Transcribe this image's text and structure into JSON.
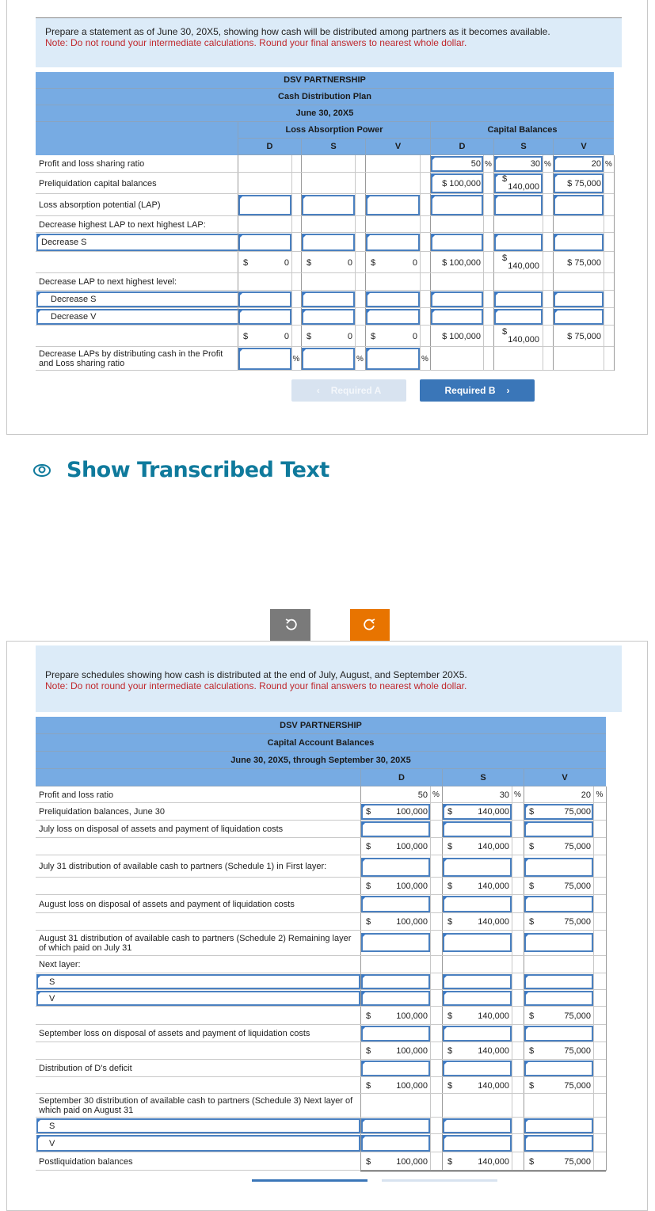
{
  "part_a": {
    "instruction": "Prepare a statement as of June 30, 20X5, showing how cash will be distributed among partners as it becomes available.",
    "note": "Note: Do not round your intermediate calculations. Round your final answers to nearest whole dollar.",
    "table": {
      "title": "DSV PARTNERSHIP",
      "subtitle": "Cash Distribution Plan",
      "date": "June 30, 20X5",
      "group_lap": "Loss Absorption Power",
      "group_cap": "Capital Balances",
      "columns": [
        "D",
        "S",
        "V",
        "D",
        "S",
        "V"
      ],
      "rows": [
        {
          "label": "Profit and loss sharing ratio",
          "lap": [
            null,
            null,
            null
          ],
          "cap": [
            {
              "t": "inval",
              "v": "50",
              "s": "%"
            },
            {
              "t": "inval",
              "v": "30",
              "s": "%"
            },
            {
              "t": "inval",
              "v": "20",
              "s": "%"
            }
          ]
        },
        {
          "label": "Preliquidation capital balances",
          "lap": [
            null,
            null,
            null
          ],
          "cap": [
            {
              "t": "inval",
              "v": "$ 100,000"
            },
            {
              "t": "inval2",
              "v": "140,000",
              "p": "$"
            },
            {
              "t": "inval",
              "v": "$ 75,000"
            }
          ]
        },
        {
          "label": "Loss absorption potential (LAP)",
          "lap": [
            {
              "t": "in"
            },
            {
              "t": "in"
            },
            {
              "t": "in"
            }
          ],
          "cap": [
            {
              "t": "in"
            },
            {
              "t": "in"
            },
            {
              "t": "in"
            }
          ]
        },
        {
          "label": "Decrease highest LAP to next highest LAP:",
          "lap": [
            null,
            null,
            null
          ],
          "cap": [
            null,
            null,
            null
          ]
        },
        {
          "label": "Decrease S",
          "select": true,
          "lap": [
            {
              "t": "in"
            },
            {
              "t": "in"
            },
            {
              "t": "in"
            }
          ],
          "cap": [
            {
              "t": "in"
            },
            {
              "t": "in"
            },
            {
              "t": "in"
            }
          ]
        },
        {
          "label": "",
          "lap": [
            {
              "t": "val",
              "p": "$",
              "v": "0"
            },
            {
              "t": "val",
              "p": "$",
              "v": "0"
            },
            {
              "t": "val",
              "p": "$",
              "v": "0"
            }
          ],
          "cap": [
            {
              "t": "val",
              "v": "$ 100,000"
            },
            {
              "t": "val2",
              "p": "$",
              "v": "140,000"
            },
            {
              "t": "val",
              "v": "$ 75,000"
            }
          ]
        },
        {
          "label": "Decrease LAP to next highest level:",
          "lap": [
            null,
            null,
            null
          ],
          "cap": [
            null,
            null,
            null
          ]
        },
        {
          "label": "Decrease S",
          "select": true,
          "indent": true,
          "lap": [
            {
              "t": "in"
            },
            {
              "t": "in"
            },
            {
              "t": "in"
            }
          ],
          "cap": [
            {
              "t": "in"
            },
            {
              "t": "in"
            },
            {
              "t": "in"
            }
          ]
        },
        {
          "label": "Decrease V",
          "select": true,
          "indent": true,
          "lap": [
            {
              "t": "in"
            },
            {
              "t": "in"
            },
            {
              "t": "in"
            }
          ],
          "cap": [
            {
              "t": "in"
            },
            {
              "t": "in"
            },
            {
              "t": "in"
            }
          ]
        },
        {
          "label": "",
          "lap": [
            {
              "t": "val",
              "p": "$",
              "v": "0"
            },
            {
              "t": "val",
              "p": "$",
              "v": "0"
            },
            {
              "t": "val",
              "p": "$",
              "v": "0"
            }
          ],
          "cap": [
            {
              "t": "val",
              "v": "$ 100,000"
            },
            {
              "t": "val2",
              "p": "$",
              "v": "140,000"
            },
            {
              "t": "val",
              "v": "$ 75,000"
            }
          ]
        },
        {
          "label": "Decrease LAPs by distributing cash in the Profit and Loss sharing ratio",
          "lap": [
            {
              "t": "in",
              "s": "%"
            },
            {
              "t": "in",
              "s": "%"
            },
            {
              "t": "in",
              "s": "%"
            }
          ],
          "cap": [
            null,
            null,
            null
          ]
        }
      ]
    },
    "nav": {
      "prev_label": "Required A",
      "next_label": "Required B"
    }
  },
  "transcribed": {
    "label": "Show Transcribed Text"
  },
  "toolbar": {
    "undo": "undo-icon",
    "redo": "redo-icon",
    "redo_color": "#e87400"
  },
  "part_b": {
    "instruction": "Prepare schedules showing how cash is distributed at the end of July, August, and September 20X5.",
    "note": "Note: Do not round your intermediate calculations. Round your final answers to nearest whole dollar.",
    "table": {
      "title": "DSV PARTNERSHIP",
      "subtitle": "Capital Account Balances",
      "date": "June 30, 20X5, through September 30, 20X5",
      "columns": [
        "D",
        "S",
        "V"
      ],
      "rows": [
        {
          "label": "Profit and loss ratio",
          "cells": [
            {
              "t": "pct",
              "v": "50"
            },
            {
              "t": "pct",
              "v": "30"
            },
            {
              "t": "pct",
              "v": "20"
            }
          ]
        },
        {
          "label": "Preliquidation balances, June 30",
          "cells": [
            {
              "t": "inval",
              "p": "$",
              "v": "100,000"
            },
            {
              "t": "inval",
              "p": "$",
              "v": "140,000"
            },
            {
              "t": "inval",
              "p": "$",
              "v": "75,000"
            }
          ]
        },
        {
          "label": "July loss on disposal of assets and payment of liquidation costs",
          "cells": [
            {
              "t": "in"
            },
            {
              "t": "in"
            },
            {
              "t": "in"
            }
          ]
        },
        {
          "label": "",
          "cells": [
            {
              "t": "val",
              "p": "$",
              "v": "100,000"
            },
            {
              "t": "val",
              "p": "$",
              "v": "140,000"
            },
            {
              "t": "val",
              "p": "$",
              "v": "75,000"
            }
          ]
        },
        {
          "label": "July 31 distribution of available cash to partners (Schedule 1) in First layer:",
          "cells": [
            {
              "t": "in"
            },
            {
              "t": "in"
            },
            {
              "t": "in"
            }
          ]
        },
        {
          "label": "",
          "cells": [
            {
              "t": "val",
              "p": "$",
              "v": "100,000"
            },
            {
              "t": "val",
              "p": "$",
              "v": "140,000"
            },
            {
              "t": "val",
              "p": "$",
              "v": "75,000"
            }
          ]
        },
        {
          "label": "August loss on disposal of assets and payment of liquidation costs",
          "cells": [
            {
              "t": "in"
            },
            {
              "t": "in"
            },
            {
              "t": "in"
            }
          ]
        },
        {
          "label": "",
          "cells": [
            {
              "t": "val",
              "p": "$",
              "v": "100,000"
            },
            {
              "t": "val",
              "p": "$",
              "v": "140,000"
            },
            {
              "t": "val",
              "p": "$",
              "v": "75,000"
            }
          ]
        },
        {
          "label": "August 31 distribution of available cash to partners (Schedule 2) Remaining layer of which paid on July 31",
          "cells": [
            {
              "t": "in"
            },
            {
              "t": "in"
            },
            {
              "t": "in"
            }
          ]
        },
        {
          "label": "Next layer:",
          "cells": [
            null,
            null,
            null
          ]
        },
        {
          "label": "S",
          "select": true,
          "cells": [
            {
              "t": "in"
            },
            {
              "t": "in"
            },
            {
              "t": "in"
            }
          ]
        },
        {
          "label": "V",
          "select": true,
          "cells": [
            {
              "t": "in"
            },
            {
              "t": "in"
            },
            {
              "t": "in"
            }
          ]
        },
        {
          "label": "",
          "cells": [
            {
              "t": "val",
              "p": "$",
              "v": "100,000"
            },
            {
              "t": "val",
              "p": "$",
              "v": "140,000"
            },
            {
              "t": "val",
              "p": "$",
              "v": "75,000"
            }
          ]
        },
        {
          "label": "September loss on disposal of assets and payment of liquidation costs",
          "cells": [
            {
              "t": "in"
            },
            {
              "t": "in"
            },
            {
              "t": "in"
            }
          ]
        },
        {
          "label": "",
          "cells": [
            {
              "t": "val",
              "p": "$",
              "v": "100,000"
            },
            {
              "t": "val",
              "p": "$",
              "v": "140,000"
            },
            {
              "t": "val",
              "p": "$",
              "v": "75,000"
            }
          ]
        },
        {
          "label": "Distribution of D's deficit",
          "cells": [
            {
              "t": "in"
            },
            {
              "t": "in"
            },
            {
              "t": "in"
            }
          ]
        },
        {
          "label": "",
          "cells": [
            {
              "t": "val",
              "p": "$",
              "v": "100,000"
            },
            {
              "t": "val",
              "p": "$",
              "v": "140,000"
            },
            {
              "t": "val",
              "p": "$",
              "v": "75,000"
            }
          ]
        },
        {
          "label": "September 30 distribution of available cash to partners (Schedule 3) Next layer of which paid on August 31",
          "cells": [
            null,
            null,
            null
          ]
        },
        {
          "label": "S",
          "select": true,
          "cells": [
            {
              "t": "in"
            },
            {
              "t": "in"
            },
            {
              "t": "in"
            }
          ]
        },
        {
          "label": "V",
          "select": true,
          "cells": [
            {
              "t": "in"
            },
            {
              "t": "in"
            },
            {
              "t": "in"
            }
          ]
        },
        {
          "label": "Postliquidation balances",
          "cells": [
            {
              "t": "val",
              "p": "$",
              "v": "100,000"
            },
            {
              "t": "val",
              "p": "$",
              "v": "140,000"
            },
            {
              "t": "val",
              "p": "$",
              "v": "75,000"
            }
          ]
        }
      ]
    }
  }
}
